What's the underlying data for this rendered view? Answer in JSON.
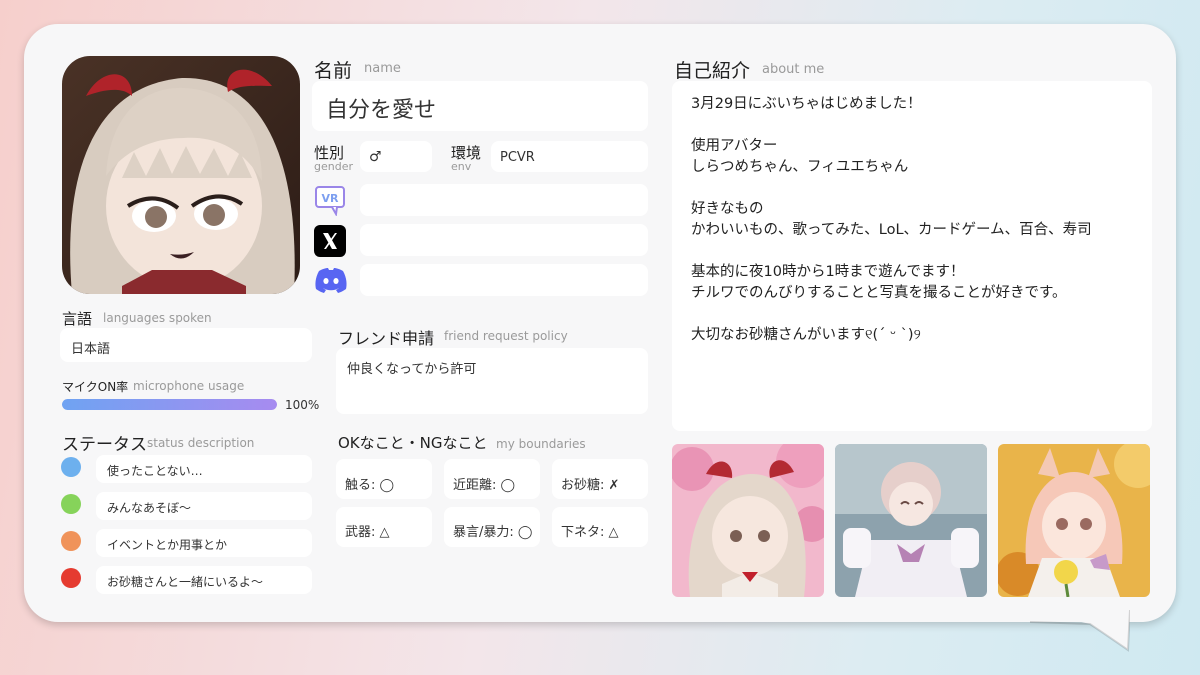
{
  "name": {
    "label": "名前",
    "sub": "name",
    "value": "自分を愛せ"
  },
  "gender": {
    "label": "性別",
    "sub": "gender",
    "value": "♂"
  },
  "env": {
    "label": "環境",
    "sub": "env",
    "value": "PCVR"
  },
  "socials": [
    {
      "icon": "vrchat-icon",
      "value": ""
    },
    {
      "icon": "x-icon",
      "value": ""
    },
    {
      "icon": "discord-icon",
      "value": ""
    }
  ],
  "languages": {
    "label": "言語",
    "sub": "languages spoken",
    "value": "日本語"
  },
  "mic": {
    "label": "マイクON率",
    "sub": "microphone usage",
    "percent": 100,
    "percent_text": "100%"
  },
  "status": {
    "label": "ステータス",
    "sub": "status description",
    "items": [
      {
        "color": "#6db0ee",
        "text": "使ったことない…"
      },
      {
        "color": "#86d35a",
        "text": "みんなあそぼ〜"
      },
      {
        "color": "#f0935a",
        "text": "イベントとか用事とか"
      },
      {
        "color": "#e53b30",
        "text": "お砂糖さんと一緒にいるよ〜"
      }
    ]
  },
  "friend": {
    "label": "フレンド申請",
    "sub": "friend request policy",
    "value": "仲良くなってから許可"
  },
  "boundaries": {
    "label": "OKなこと・NGなこと",
    "sub": "my boundaries",
    "items": [
      "触る: ◯",
      "近距離: ◯",
      "お砂糖: ✗",
      "武器: △",
      "暴言/暴力: ◯",
      "下ネタ: △"
    ]
  },
  "about": {
    "label": "自己紹介",
    "sub": "about me",
    "text": "3月29日にぶいちゃはじめました！\n\n使用アバター\nしらつめちゃん、フィユエちゃん\n\n好きなもの\nかわいいもの、歌ってみた、LoL、カードゲーム、百合、寿司\n\n基本的に夜10時から1時まで遊んでます！\nチルワでのんびりすることと写真を撮ることが好きです。\n\n大切なお砂糖さんがいます୧(ˊ ᵕ ˋ)୨"
  }
}
